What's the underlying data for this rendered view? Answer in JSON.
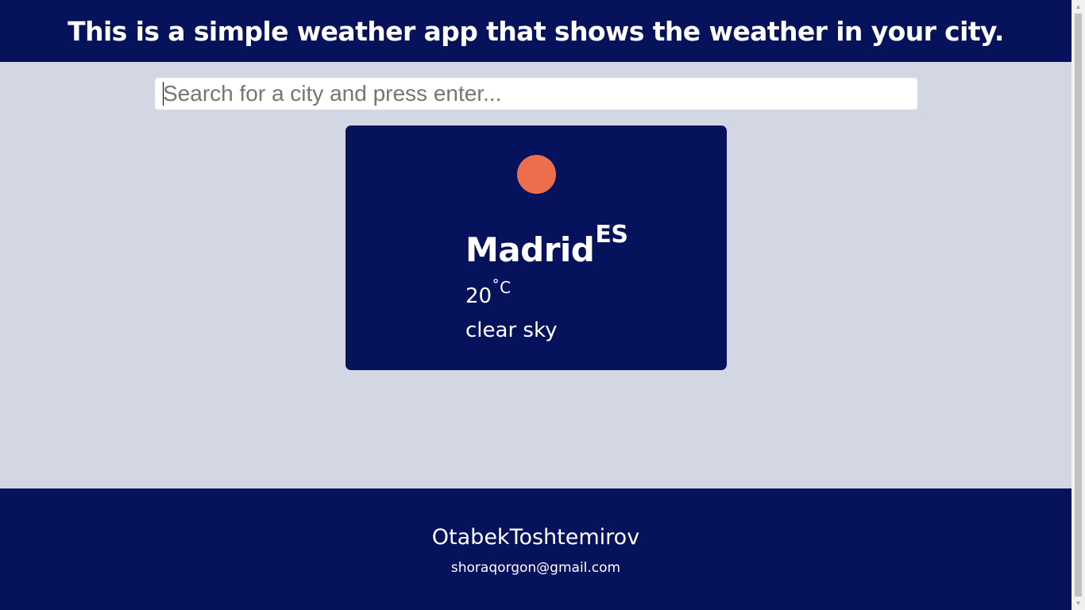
{
  "header": {
    "title": "This is a simple weather app that shows the weather in your city."
  },
  "search": {
    "placeholder": "Search for a city and press enter...",
    "value": ""
  },
  "weather": {
    "icon": "sun-icon",
    "icon_color": "#ec6e4c",
    "city": "Madrid",
    "country": "ES",
    "temperature": "20",
    "unit": "˚C",
    "description": "clear sky"
  },
  "footer": {
    "name": "OtabekToshtemirov",
    "email": "shoraqorgon@gmail.com"
  },
  "colors": {
    "primary": "#07125c",
    "background": "#d3d7e3",
    "accent": "#ec6e4c"
  }
}
